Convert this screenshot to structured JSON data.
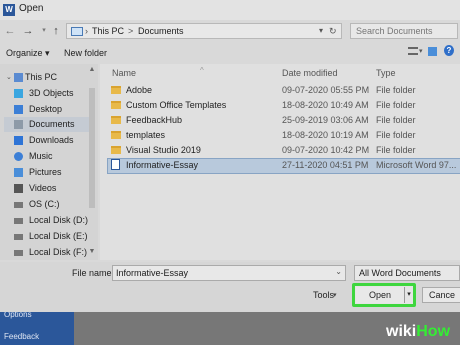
{
  "window": {
    "title": "Open",
    "app_icon": "word-icon"
  },
  "address": {
    "segments": [
      "This PC",
      "Documents"
    ],
    "separator": ">"
  },
  "search": {
    "placeholder": "Search Documents"
  },
  "toolbar": {
    "organize": "Organize ▾",
    "new_folder": "New folder"
  },
  "sidebar": {
    "items": [
      {
        "label": "This PC",
        "icon": "pc-icon",
        "color": "#5b8bd1"
      },
      {
        "label": "3D Objects",
        "icon": "cube-icon",
        "color": "#3aa6e0"
      },
      {
        "label": "Desktop",
        "icon": "desktop-icon",
        "color": "#3c7fd6"
      },
      {
        "label": "Documents",
        "icon": "documents-icon",
        "color": "#8d9aa8"
      },
      {
        "label": "Downloads",
        "icon": "download-icon",
        "color": "#2e74d6"
      },
      {
        "label": "Music",
        "icon": "music-icon",
        "color": "#3c7fd6"
      },
      {
        "label": "Pictures",
        "icon": "pictures-icon",
        "color": "#4a8ed9"
      },
      {
        "label": "Videos",
        "icon": "videos-icon",
        "color": "#555555"
      },
      {
        "label": "OS (C:)",
        "icon": "drive-icon",
        "color": "#777777"
      },
      {
        "label": "Local Disk (D:)",
        "icon": "drive-icon",
        "color": "#777777"
      },
      {
        "label": "Local Disk (E:)",
        "icon": "drive-icon",
        "color": "#777777"
      },
      {
        "label": "Local Disk (F:)",
        "icon": "drive-icon",
        "color": "#777777"
      }
    ],
    "selected": "Documents"
  },
  "filelist": {
    "columns": {
      "name": "Name",
      "date": "Date modified",
      "type": "Type"
    },
    "rows": [
      {
        "name": "Adobe",
        "date": "09-07-2020 05:55 PM",
        "type": "File folder",
        "icon": "folder-icon"
      },
      {
        "name": "Custom Office Templates",
        "date": "18-08-2020 10:49 AM",
        "type": "File folder",
        "icon": "folder-icon"
      },
      {
        "name": "FeedbackHub",
        "date": "25-09-2019 03:06 AM",
        "type": "File folder",
        "icon": "folder-icon"
      },
      {
        "name": "templates",
        "date": "18-08-2020 10:19 AM",
        "type": "File folder",
        "icon": "folder-icon"
      },
      {
        "name": "Visual Studio 2019",
        "date": "09-07-2020 10:42 PM",
        "type": "File folder",
        "icon": "folder-icon"
      },
      {
        "name": "Informative-Essay",
        "date": "27-11-2020 04:51 PM",
        "type": "Microsoft Word 97...",
        "icon": "word-doc-icon"
      }
    ],
    "selected": "Informative-Essay"
  },
  "bottom": {
    "file_name_label": "File name:",
    "file_name_value": "Informative-Essay",
    "filter_value": "All Word Documents",
    "tools": "Tools",
    "open": "Open",
    "cancel": "Cance"
  },
  "backdrop": {
    "items": [
      "Options",
      "Feedback"
    ]
  },
  "watermark": {
    "wiki": "wiki",
    "how": "How"
  },
  "colors": {
    "highlight": "#3ed63e",
    "accent": "#2b579a"
  }
}
